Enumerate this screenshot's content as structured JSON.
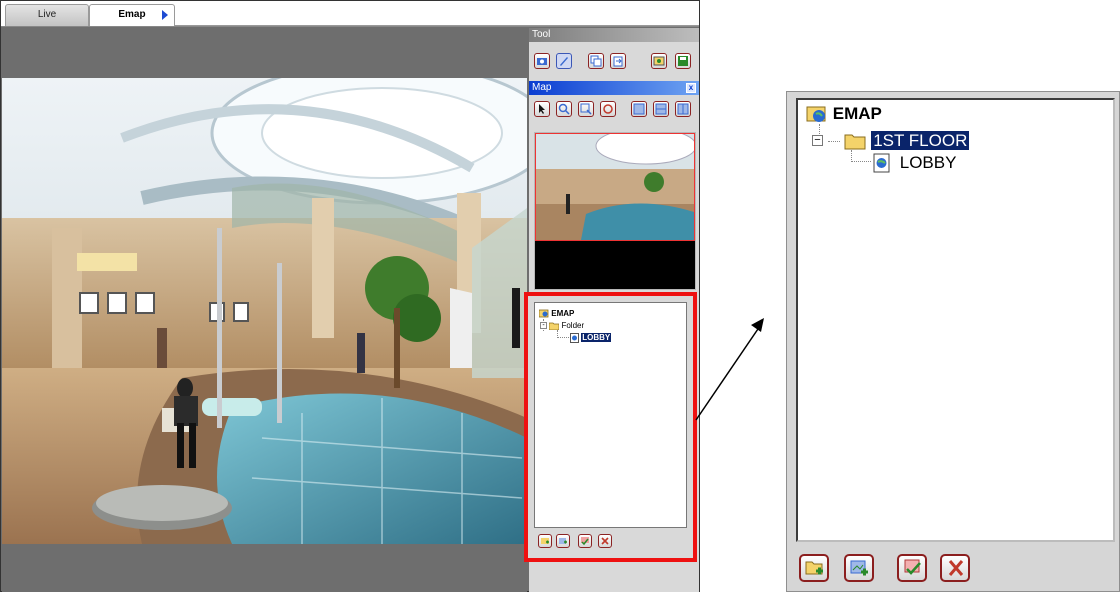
{
  "tabs": {
    "live": "Live",
    "emap": "Emap"
  },
  "tool_panel": {
    "title": "Tool",
    "icons": [
      "camera-icon",
      "edit-icon",
      "copy-icon",
      "paste-icon",
      "import-icon",
      "save-icon"
    ]
  },
  "map_panel": {
    "title": "Map",
    "close_glyph": "x",
    "icons": [
      "pointer-icon",
      "zoom-in-icon",
      "zoom-out-icon",
      "pan-icon",
      "layout-1-icon",
      "layout-2-icon",
      "layout-3-icon"
    ]
  },
  "tree_small": {
    "root": "EMAP",
    "folder": "Folder",
    "map": "LOBBY",
    "selected": "LOBBY"
  },
  "tree_zoom": {
    "root": "EMAP",
    "folder": "1ST FLOOR",
    "map": "LOBBY",
    "selected": "1ST FLOOR",
    "expand_glyph": "−"
  },
  "tree_buttons": [
    "add-folder-icon",
    "add-map-icon",
    "edit-map-icon",
    "delete-icon"
  ],
  "colors": {
    "highlight_border": "#ee1111",
    "selection_bg": "#0a246a",
    "title_blue": "#0a3dd1",
    "button_border": "#8b1e1e"
  }
}
